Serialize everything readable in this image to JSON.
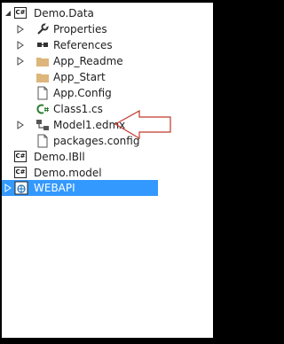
{
  "tree": {
    "items": [
      {
        "label": "Demo.Data",
        "icon": "csharp-project-icon",
        "expander": "expanded"
      },
      {
        "label": "Properties",
        "icon": "wrench-icon",
        "expander": "collapsed"
      },
      {
        "label": "References",
        "icon": "references-icon",
        "expander": "collapsed"
      },
      {
        "label": "App_Readme",
        "icon": "folder-icon",
        "expander": "collapsed"
      },
      {
        "label": "App_Start",
        "icon": "folder-icon",
        "expander": "none"
      },
      {
        "label": "App.Config",
        "icon": "config-file-icon",
        "expander": "none"
      },
      {
        "label": "Class1.cs",
        "icon": "csharp-file-icon",
        "expander": "none"
      },
      {
        "label": "Model1.edmx",
        "icon": "edmx-icon",
        "expander": "collapsed"
      },
      {
        "label": "packages.config",
        "icon": "config-file-icon",
        "expander": "none"
      },
      {
        "label": "Demo.IBll",
        "icon": "csharp-project-icon",
        "expander": "none"
      },
      {
        "label": "Demo.model",
        "icon": "csharp-project-icon",
        "expander": "none"
      },
      {
        "label": "WEBAPI",
        "icon": "web-project-icon",
        "expander": "collapsed",
        "selected": true
      }
    ],
    "csharp_badge": "C#"
  },
  "colors": {
    "selection": "#3399ff",
    "annotation_arrow": "#c0392b",
    "folder": "#dcb67a"
  }
}
